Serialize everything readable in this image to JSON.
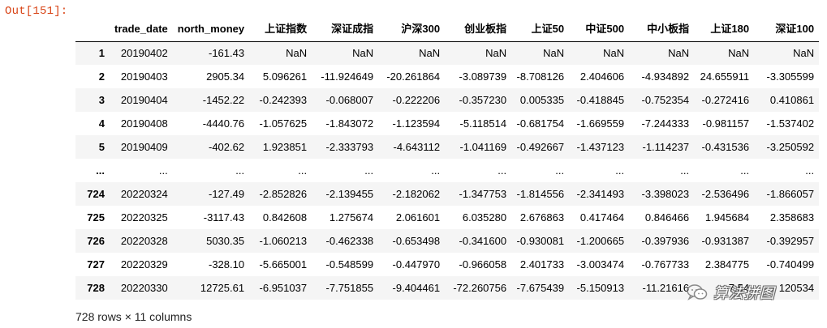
{
  "output_prompt": "Out[151]:",
  "table": {
    "columns": [
      "",
      "trade_date",
      "north_money",
      "上证指数",
      "深证成指",
      "沪深300",
      "创业板指",
      "上证50",
      "中证500",
      "中小板指",
      "上证180",
      "深证100"
    ],
    "rows": [
      [
        "1",
        "20190402",
        "-161.43",
        "NaN",
        "NaN",
        "NaN",
        "NaN",
        "NaN",
        "NaN",
        "NaN",
        "NaN",
        "NaN"
      ],
      [
        "2",
        "20190403",
        "2905.34",
        "5.096261",
        "-11.924649",
        "-20.261864",
        "-3.089739",
        "-8.708126",
        "2.404606",
        "-4.934892",
        "24.655911",
        "-3.305599"
      ],
      [
        "3",
        "20190404",
        "-1452.22",
        "-0.242393",
        "-0.068007",
        "-0.222206",
        "-0.357230",
        "0.005335",
        "-0.418845",
        "-0.752354",
        "-0.272416",
        "0.410861"
      ],
      [
        "4",
        "20190408",
        "-4440.76",
        "-1.057625",
        "-1.843072",
        "-1.123594",
        "-5.118514",
        "-0.681754",
        "-1.669559",
        "-7.244333",
        "-0.981157",
        "-1.537402"
      ],
      [
        "5",
        "20190409",
        "-402.62",
        "1.923851",
        "-2.333793",
        "-4.643112",
        "-1.041169",
        "-0.492667",
        "-1.437123",
        "-1.114237",
        "-0.431536",
        "-3.250592"
      ],
      [
        "...",
        "...",
        "...",
        "...",
        "...",
        "...",
        "...",
        "...",
        "...",
        "...",
        "...",
        "..."
      ],
      [
        "724",
        "20220324",
        "-127.49",
        "-2.852826",
        "-2.139455",
        "-2.182062",
        "-1.347753",
        "-1.814556",
        "-2.341493",
        "-3.398023",
        "-2.536496",
        "-1.866057"
      ],
      [
        "725",
        "20220325",
        "-3117.43",
        "0.842608",
        "1.275674",
        "2.061601",
        "6.035280",
        "2.676863",
        "0.417464",
        "0.846466",
        "1.945684",
        "2.358683"
      ],
      [
        "726",
        "20220328",
        "5030.35",
        "-1.060213",
        "-0.462338",
        "-0.653498",
        "-0.341600",
        "-0.930081",
        "-1.200665",
        "-0.397936",
        "-0.931387",
        "-0.392957"
      ],
      [
        "727",
        "20220329",
        "-328.10",
        "-5.665001",
        "-0.548599",
        "-0.447970",
        "-0.966058",
        "2.401733",
        "-3.003474",
        "-0.767733",
        "2.384775",
        "-0.740499"
      ],
      [
        "728",
        "20220330",
        "12725.61",
        "-6.951037",
        "-7.751855",
        "-9.404461",
        "-72.260756",
        "-7.675439",
        "-5.150913",
        "-11.21616",
        "-7.54",
        "120534"
      ]
    ]
  },
  "shape_note": "728 rows × 11 columns",
  "watermark": {
    "text": "算法拼图",
    "icon": "wechat-bubbles-icon"
  },
  "colors": {
    "prompt": "#d84315",
    "stripe": "#f5f5f5",
    "header_rule": "#000000"
  }
}
